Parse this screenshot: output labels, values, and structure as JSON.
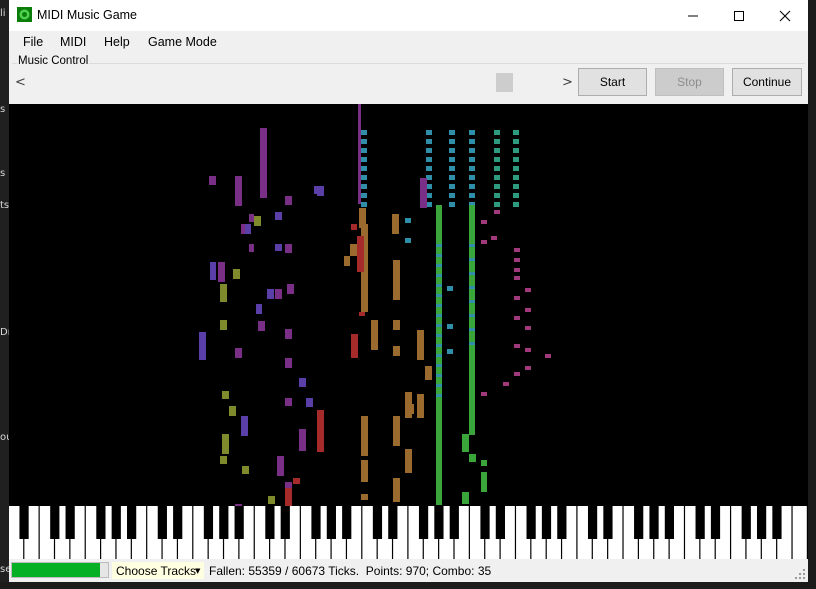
{
  "window": {
    "title": "MIDI Music Game",
    "controls": {
      "minimize": "minimize-icon",
      "maximize": "maximize-icon",
      "close": "close-icon"
    }
  },
  "menu": [
    {
      "label": "File"
    },
    {
      "label": "MIDI"
    },
    {
      "label": "Help"
    },
    {
      "label": "Game Mode"
    }
  ],
  "music_control": {
    "group_label": "Music Control",
    "scroll_left": "<",
    "scroll_right": ">",
    "buttons": {
      "start": "Start",
      "stop": "Stop",
      "continue": "Continue"
    },
    "stop_enabled": false
  },
  "status": {
    "track_chooser": "Choose Tracks",
    "fallen_text": "Fallen: 55359 / 60673 Ticks.  Points: 970; Combo: 35",
    "fallen": 55359,
    "total_ticks": 60673,
    "points": 970,
    "combo": 35
  },
  "background_window_edge": {
    "glyphs": [
      "li",
      "s",
      "s",
      "ts",
      "Dr",
      "ou",
      "se"
    ]
  },
  "colors": {
    "accent_progress": "#06b025",
    "note_purple": "#7a2f86",
    "note_violet": "#5b3fa8",
    "note_olive": "#7f8a2c",
    "note_red": "#a52a2a",
    "note_brown": "#9b6a2e",
    "note_blue": "#2f8fa8",
    "note_teal": "#2e9b7f",
    "note_green": "#3aa53a",
    "note_magenta": "#a13a7a"
  }
}
